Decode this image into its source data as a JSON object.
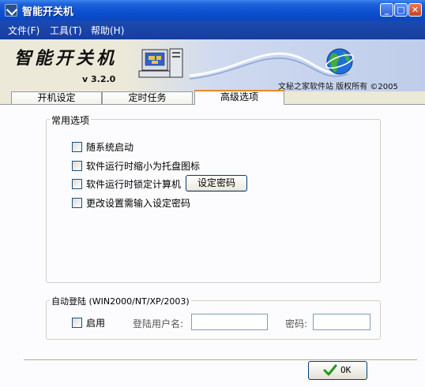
{
  "window": {
    "title": "智能开关机",
    "minimize_icon": "minimize-icon",
    "maximize_icon": "maximize-icon",
    "close_icon": "close-icon"
  },
  "menu": [
    {
      "label": "文件(F)"
    },
    {
      "label": "工具(T)"
    },
    {
      "label": "帮助(H)"
    }
  ],
  "banner": {
    "logo_text": "智能开关机",
    "version": "v 3.2.0",
    "credits": "文秘之家软件站  版权所有  ©2005"
  },
  "tabs": [
    {
      "label": "开机设定"
    },
    {
      "label": "定时任务"
    },
    {
      "label": "高级选项",
      "active": true
    }
  ],
  "common_options": {
    "label": "常用选项",
    "items": [
      {
        "label": "随系统启动",
        "checked": false
      },
      {
        "label": "软件运行时缩小为托盘图标",
        "checked": false
      },
      {
        "label": "软件运行时锁定计算机",
        "checked": false
      },
      {
        "label": "更改设置需输入设定密码",
        "checked": false
      }
    ],
    "set_password_button": "设定密码"
  },
  "auto_login": {
    "label": "自动登陆 (WIN2000/NT/XP/2003)",
    "enable_label": "启用",
    "enabled": false,
    "username_label": "登陆用户名:",
    "username_value": "",
    "password_label": "密码:",
    "password_value": ""
  },
  "ok_button": "OK",
  "colors": {
    "title_bar": "#0a50d0",
    "menu_bar": "#1d49b0",
    "active_tab_accent": "#e68b2c",
    "panel": "#fcfcfe"
  }
}
